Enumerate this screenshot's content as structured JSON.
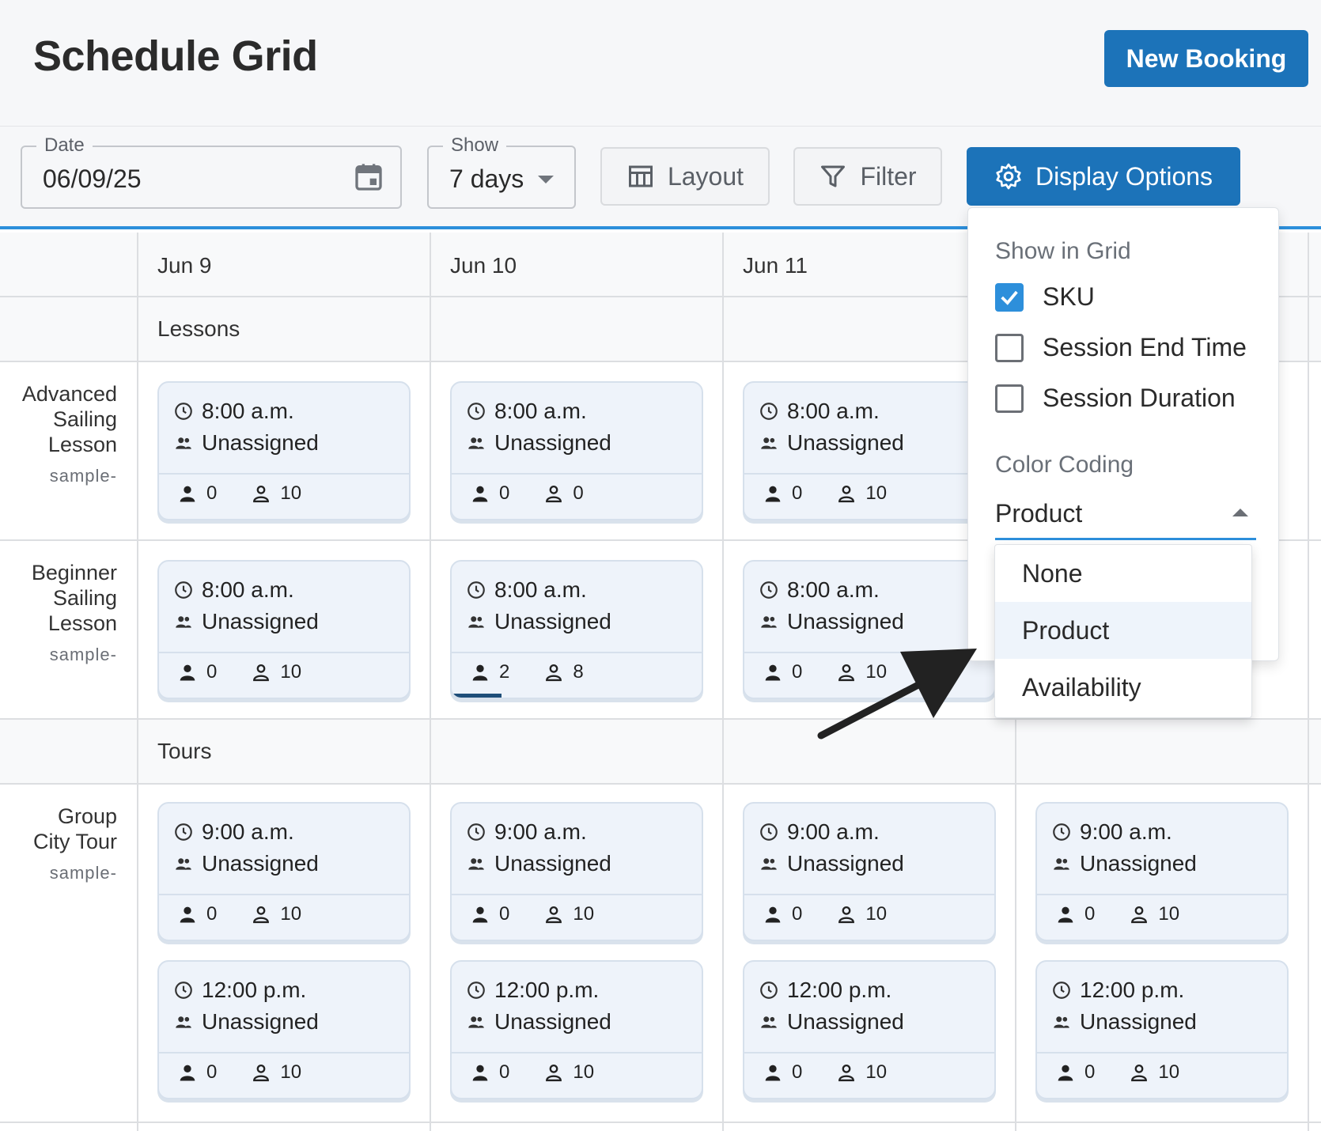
{
  "header": {
    "title": "Schedule Grid",
    "new_booking": "New Booking"
  },
  "toolbar": {
    "date_legend": "Date",
    "date_value": "06/09/25",
    "show_legend": "Show",
    "show_value": "7 days",
    "layout": "Layout",
    "filter": "Filter",
    "display_options": "Display Options"
  },
  "grid": {
    "columns": [
      "Jun 9",
      "Jun 10",
      "Jun 11"
    ],
    "groups": [
      "Lessons",
      "Tours"
    ],
    "rows": [
      {
        "name_l1": "Advanced",
        "name_l2": "Sailing",
        "name_l3": "Lesson",
        "sku": "sample-"
      },
      {
        "name_l1": "Beginner",
        "name_l2": "Sailing",
        "name_l3": "Lesson",
        "sku": "sample-"
      },
      {
        "name_l1": "Group",
        "name_l2": "City Tour",
        "sku": "sample-"
      }
    ],
    "cards": {
      "r0c0": {
        "time": "8:00 a.m.",
        "staff": "Unassigned",
        "booked": "0",
        "avail": "10"
      },
      "r0c1": {
        "time": "8:00 a.m.",
        "staff": "Unassigned",
        "booked": "0",
        "avail": "0"
      },
      "r0c2": {
        "time": "8:00 a.m.",
        "staff": "Unassigned",
        "booked": "0",
        "avail": "10"
      },
      "r1c0": {
        "time": "8:00 a.m.",
        "staff": "Unassigned",
        "booked": "0",
        "avail": "10"
      },
      "r1c1": {
        "time": "8:00 a.m.",
        "staff": "Unassigned",
        "booked": "2",
        "avail": "8",
        "fill": 0.2
      },
      "r1c2": {
        "time": "8:00 a.m.",
        "staff": "Unassigned",
        "booked": "0",
        "avail": "10"
      },
      "r2c0": {
        "time": "9:00 a.m.",
        "staff": "Unassigned",
        "booked": "0",
        "avail": "10"
      },
      "r2c1": {
        "time": "9:00 a.m.",
        "staff": "Unassigned",
        "booked": "0",
        "avail": "10"
      },
      "r2c2": {
        "time": "9:00 a.m.",
        "staff": "Unassigned",
        "booked": "0",
        "avail": "10"
      },
      "r2c3": {
        "time": "9:00 a.m.",
        "staff": "Unassigned",
        "booked": "0",
        "avail": "10"
      },
      "r3c0": {
        "time": "12:00 p.m.",
        "staff": "Unassigned",
        "booked": "0",
        "avail": "10"
      },
      "r3c1": {
        "time": "12:00 p.m.",
        "staff": "Unassigned",
        "booked": "0",
        "avail": "10"
      },
      "r3c2": {
        "time": "12:00 p.m.",
        "staff": "Unassigned",
        "booked": "0",
        "avail": "10"
      },
      "r3c3": {
        "time": "12:00 p.m.",
        "staff": "Unassigned",
        "booked": "0",
        "avail": "10"
      }
    }
  },
  "display_panel": {
    "show_in_grid": "Show in Grid",
    "sku": "SKU",
    "sku_checked": true,
    "end_time": "Session End Time",
    "end_time_checked": false,
    "duration": "Session Duration",
    "duration_checked": false,
    "color_coding": "Color Coding",
    "color_value": "Product",
    "options": [
      "None",
      "Product",
      "Availability"
    ],
    "selected_option": "Product"
  },
  "colors": {
    "accent": "#1c73b9",
    "highlight": "#2d8fdb",
    "card_bg": "#eef3fa",
    "fill_bar": "#1f4e79"
  },
  "icons": [
    "calendar-icon",
    "table-layout-icon",
    "filter-icon",
    "gear-icon",
    "clock-icon",
    "group-icon",
    "person-icon",
    "person-outline-icon",
    "check-icon",
    "arrow-annotation"
  ]
}
